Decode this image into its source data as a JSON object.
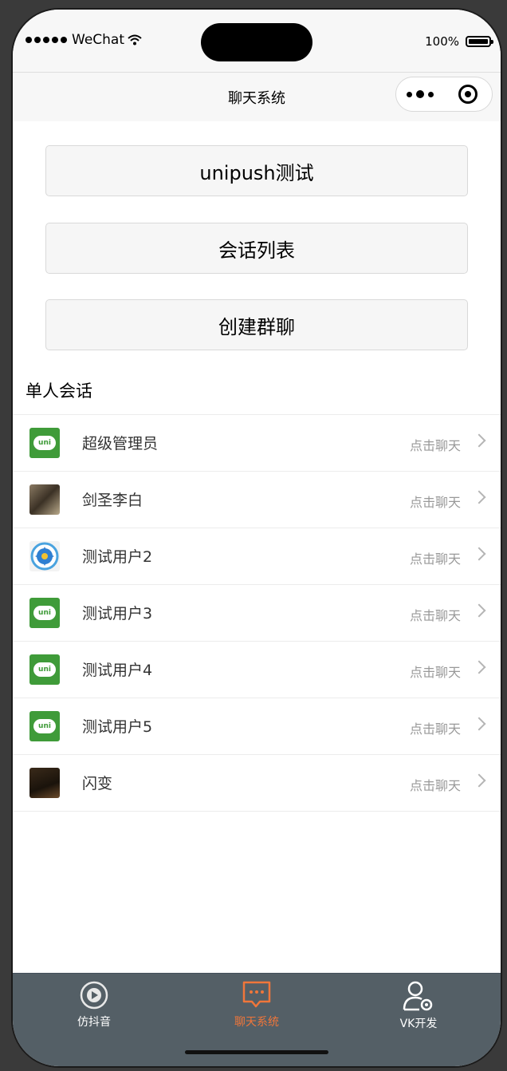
{
  "status_bar": {
    "carrier": "WeChat",
    "battery": "100%"
  },
  "nav": {
    "title": "聊天系统"
  },
  "buttons": [
    {
      "label": "unipush测试"
    },
    {
      "label": "会话列表"
    },
    {
      "label": "创建群聊"
    }
  ],
  "section": {
    "title": "单人会话"
  },
  "contacts": [
    {
      "name": "超级管理员",
      "note": "点击聊天",
      "avatar": "uni-logo"
    },
    {
      "name": "剑圣李白",
      "note": "点击聊天",
      "avatar": "photo"
    },
    {
      "name": "测试用户2",
      "note": "点击聊天",
      "avatar": "gear-badge"
    },
    {
      "name": "测试用户3",
      "note": "点击聊天",
      "avatar": "uni-logo"
    },
    {
      "name": "测试用户4",
      "note": "点击聊天",
      "avatar": "uni-logo"
    },
    {
      "name": "测试用户5",
      "note": "点击聊天",
      "avatar": "uni-logo"
    },
    {
      "name": "闪变",
      "note": "点击聊天",
      "avatar": "photo"
    }
  ],
  "tabbar": {
    "items": [
      {
        "label": "仿抖音",
        "icon": "play-circle-icon",
        "active": false
      },
      {
        "label": "聊天系统",
        "icon": "chat-bubble-icon",
        "active": true
      },
      {
        "label": "VK开发",
        "icon": "user-gear-icon",
        "active": false
      }
    ],
    "active_color": "#f0763a",
    "background": "#545f66"
  },
  "colors": {
    "uni_green": "#3f9b39"
  }
}
